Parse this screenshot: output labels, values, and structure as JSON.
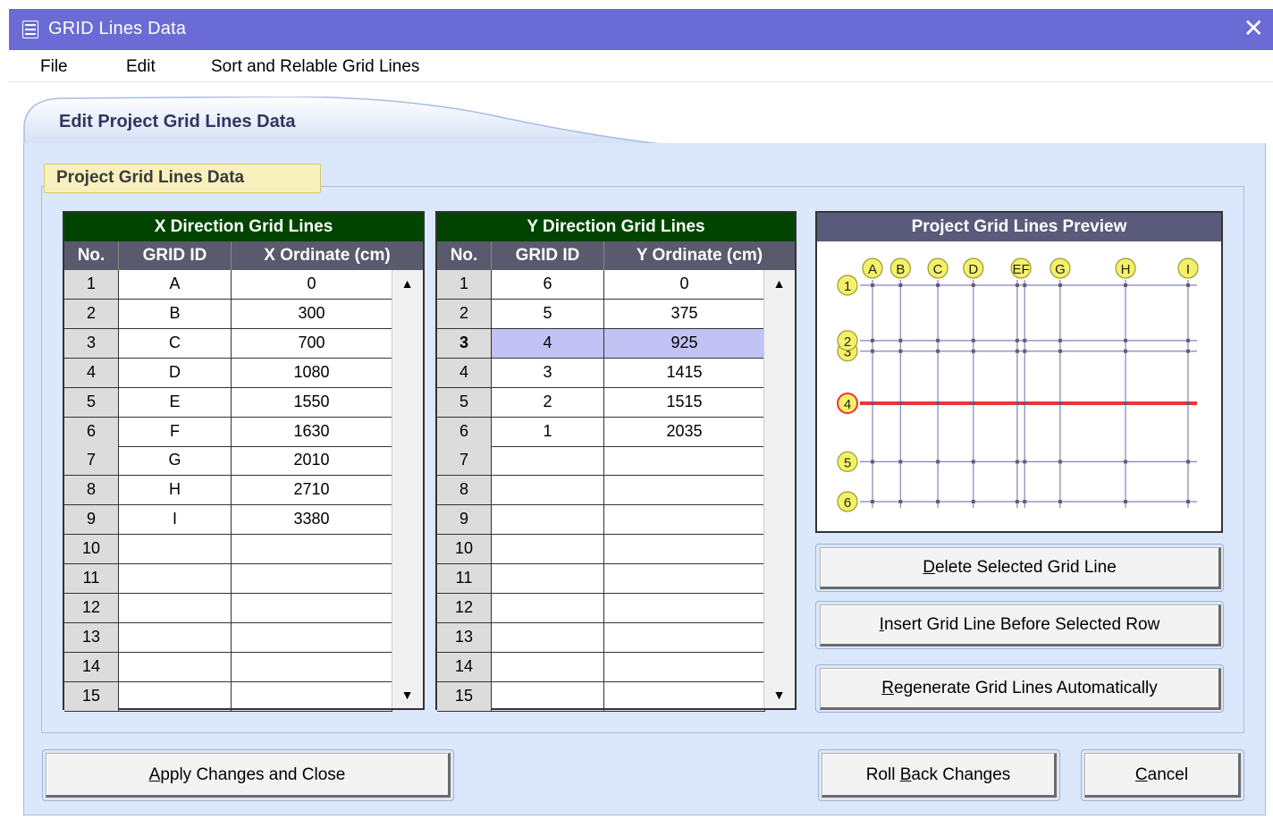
{
  "window": {
    "title": "GRID Lines Data",
    "close_glyph": "✕"
  },
  "menu": [
    "File",
    "Edit",
    "Sort and Relable Grid Lines"
  ],
  "outer_tab": "Edit Project Grid Lines Data",
  "inner_tab": "Project Grid Lines Data",
  "x_grid": {
    "title": "X Direction Grid Lines",
    "columns": [
      "No.",
      "GRID ID",
      "X Ordinate (cm)"
    ],
    "rows": [
      [
        "1",
        "A",
        "0"
      ],
      [
        "2",
        "B",
        "300"
      ],
      [
        "3",
        "C",
        "700"
      ],
      [
        "4",
        "D",
        "1080"
      ],
      [
        "5",
        "E",
        "1550"
      ],
      [
        "6",
        "F",
        "1630"
      ],
      [
        "7",
        "G",
        "2010"
      ],
      [
        "8",
        "H",
        "2710"
      ],
      [
        "9",
        "I",
        "3380"
      ],
      [
        "10",
        "",
        ""
      ],
      [
        "11",
        "",
        ""
      ],
      [
        "12",
        "",
        ""
      ],
      [
        "13",
        "",
        ""
      ],
      [
        "14",
        "",
        ""
      ],
      [
        "15",
        "",
        ""
      ]
    ]
  },
  "y_grid": {
    "title": "Y Direction Grid Lines",
    "columns": [
      "No.",
      "GRID ID",
      "Y Ordinate (cm)"
    ],
    "selected_row": 3,
    "rows": [
      [
        "1",
        "6",
        "0"
      ],
      [
        "2",
        "5",
        "375"
      ],
      [
        "3",
        "4",
        "925"
      ],
      [
        "4",
        "3",
        "1415"
      ],
      [
        "5",
        "2",
        "1515"
      ],
      [
        "6",
        "1",
        "2035"
      ],
      [
        "7",
        "",
        ""
      ],
      [
        "8",
        "",
        ""
      ],
      [
        "9",
        "",
        ""
      ],
      [
        "10",
        "",
        ""
      ],
      [
        "11",
        "",
        ""
      ],
      [
        "12",
        "",
        ""
      ],
      [
        "13",
        "",
        ""
      ],
      [
        "14",
        "",
        ""
      ],
      [
        "15",
        "",
        ""
      ]
    ]
  },
  "preview": {
    "title": "Project Grid Lines Preview",
    "x_labels": [
      "A",
      "B",
      "C",
      "D",
      "E",
      "F",
      "G",
      "H",
      "I"
    ],
    "x_label_display": [
      "A",
      "B",
      "C",
      "D",
      "EF",
      "G",
      "H",
      "I"
    ],
    "y_labels": [
      "1",
      "3",
      "2",
      "4",
      "5",
      "6"
    ],
    "highlight_y": "4",
    "colors": {
      "grid": "#8a80b8",
      "highlight": "#ee3333",
      "bubble": "#f5f06a",
      "bubble_stroke": "#9a9a30",
      "highlight_bubble": "#ee3333"
    }
  },
  "buttons": {
    "delete": {
      "mnemonic": "D",
      "rest": "elete Selected Grid Line"
    },
    "insert": {
      "mnemonic": "I",
      "rest": "nsert Grid Line Before Selected Row"
    },
    "regenerate": {
      "mnemonic": "R",
      "rest": "egenerate Grid Lines Automatically"
    },
    "apply": {
      "mnemonic": "A",
      "rest": "pply Changes and Close"
    },
    "rollback": {
      "pre": "Roll ",
      "mnemonic": "B",
      "rest": "ack Changes"
    },
    "cancel": {
      "mnemonic": "C",
      "rest": "ancel"
    }
  },
  "scroll": {
    "up": "▲",
    "down": "▼"
  }
}
